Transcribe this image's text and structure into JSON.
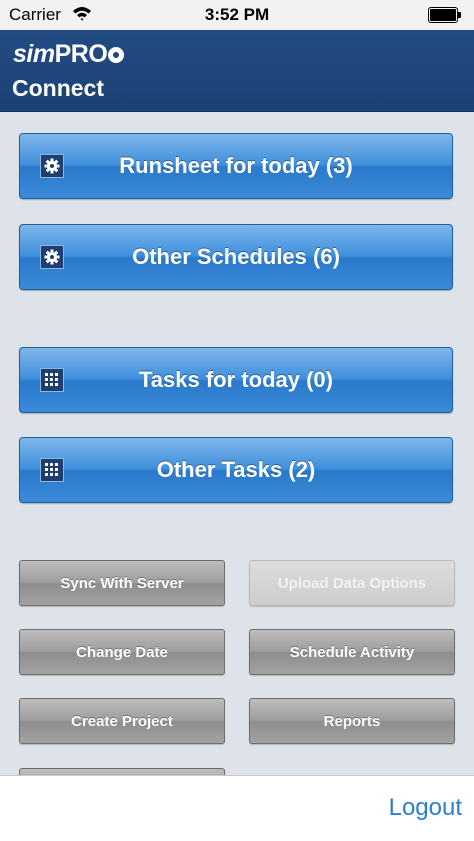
{
  "status_bar": {
    "carrier": "Carrier",
    "time": "3:52 PM",
    "wifi_icon": "wifi-icon",
    "battery_icon": "battery-icon"
  },
  "header": {
    "logo_sim": "sim",
    "logo_pro": "PRO",
    "subtitle": "Connect",
    "background_color": "#1f467c"
  },
  "main_buttons": [
    {
      "label": "Runsheet for today (3)",
      "icon": "gear-icon"
    },
    {
      "label": "Other Schedules (6)",
      "icon": "gear-icon"
    },
    {
      "label": "Tasks for today (0)",
      "icon": "grid-icon"
    },
    {
      "label": "Other Tasks (2)",
      "icon": "grid-icon"
    }
  ],
  "actions": {
    "sync": "Sync With Server",
    "upload": "Upload Data Options",
    "change_date": "Change Date",
    "schedule_activity": "Schedule Activity",
    "create_project": "Create Project",
    "reports": "Reports",
    "extra": ""
  },
  "footer": {
    "logout": "Logout",
    "link_color": "#2b7fd0"
  }
}
